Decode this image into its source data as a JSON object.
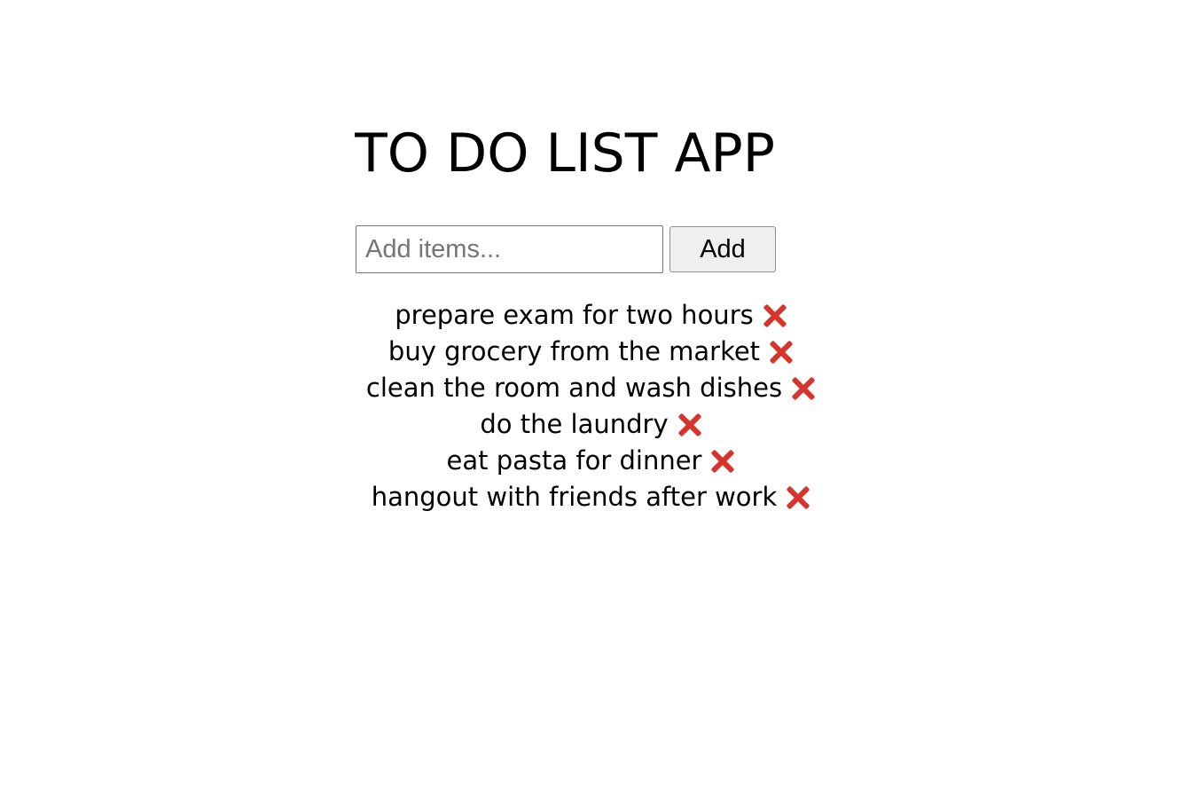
{
  "app": {
    "title": "TO DO LIST APP"
  },
  "form": {
    "input_value": "",
    "input_placeholder": "Add items...",
    "add_label": "Add"
  },
  "items": [
    {
      "text": "prepare exam for two hours",
      "delete_icon": "close-icon"
    },
    {
      "text": "buy grocery from the market",
      "delete_icon": "close-icon"
    },
    {
      "text": "clean the room and wash dishes",
      "delete_icon": "close-icon"
    },
    {
      "text": "do the laundry",
      "delete_icon": "close-icon"
    },
    {
      "text": "eat pasta for dinner",
      "delete_icon": "close-icon"
    },
    {
      "text": "hangout with friends after work",
      "delete_icon": "close-icon"
    }
  ],
  "colors": {
    "delete_icon": "#d9342b",
    "button_bg": "#efefef"
  }
}
